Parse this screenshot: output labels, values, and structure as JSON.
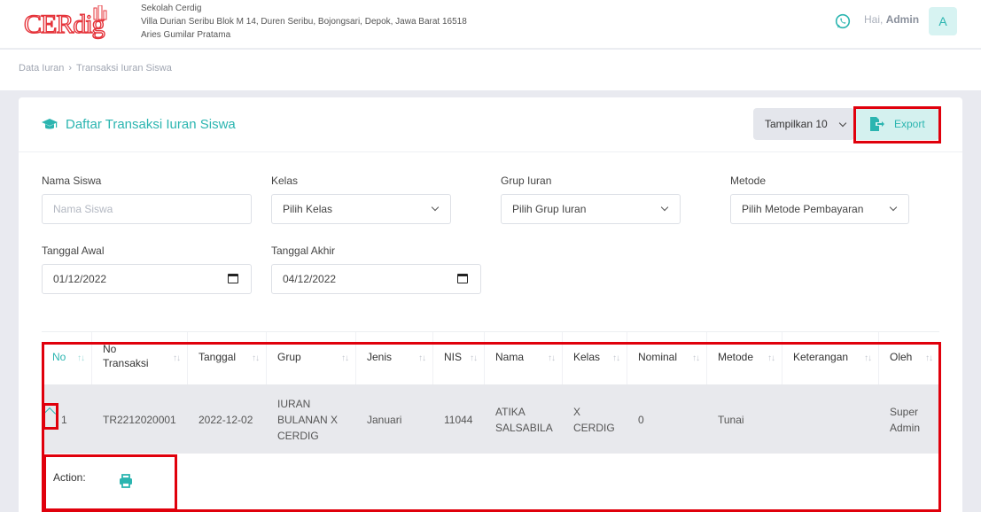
{
  "header": {
    "logo_text": "CERdig",
    "school_name": "Sekolah Cerdig",
    "school_address": "Villa Durian Seribu Blok M 14, Duren Seribu, Bojongsari, Depok, Jawa Barat 16518",
    "school_owner": "Aries Gumilar Pratama",
    "greeting_prefix": "Hai,",
    "greeting_name": "Admin",
    "avatar_initial": "A"
  },
  "breadcrumb": {
    "parent": "Data Iuran",
    "separator": "›",
    "current": "Transaksi Iuran Siswa"
  },
  "card": {
    "title": "Daftar Transaksi Iuran Siswa",
    "show_label": "Tampilkan 10",
    "export_label": "Export"
  },
  "filters": {
    "nama_siswa": {
      "label": "Nama Siswa",
      "placeholder": "Nama Siswa"
    },
    "kelas": {
      "label": "Kelas",
      "value": "Pilih Kelas"
    },
    "grup_iuran": {
      "label": "Grup Iuran",
      "value": "Pilih Grup Iuran"
    },
    "metode": {
      "label": "Metode",
      "value": "Pilih Metode Pembayaran"
    },
    "tanggal_awal": {
      "label": "Tanggal Awal",
      "value": "01/12/2022"
    },
    "tanggal_akhir": {
      "label": "Tanggal Akhir",
      "value": "04/12/2022"
    }
  },
  "table": {
    "sort_glyph": "↑↓",
    "columns": [
      "No",
      "No Transaksi",
      "Tanggal",
      "Grup",
      "Jenis",
      "NIS",
      "Nama",
      "Kelas",
      "Nominal",
      "Metode",
      "Keterangan",
      "Oleh"
    ],
    "rows": [
      [
        "1",
        "TR2212020001",
        "2022-12-02",
        "IURAN BULANAN X CERDIG",
        "Januari",
        "11044",
        "ATIKA SALSABILA",
        "X CERDIG",
        "0",
        "Tunai",
        "",
        "Super Admin"
      ]
    ],
    "action_label": "Action:"
  },
  "colors": {
    "accent": "#2bb5b0",
    "highlight": "#e0000c",
    "brand_red": "#e5343b"
  }
}
